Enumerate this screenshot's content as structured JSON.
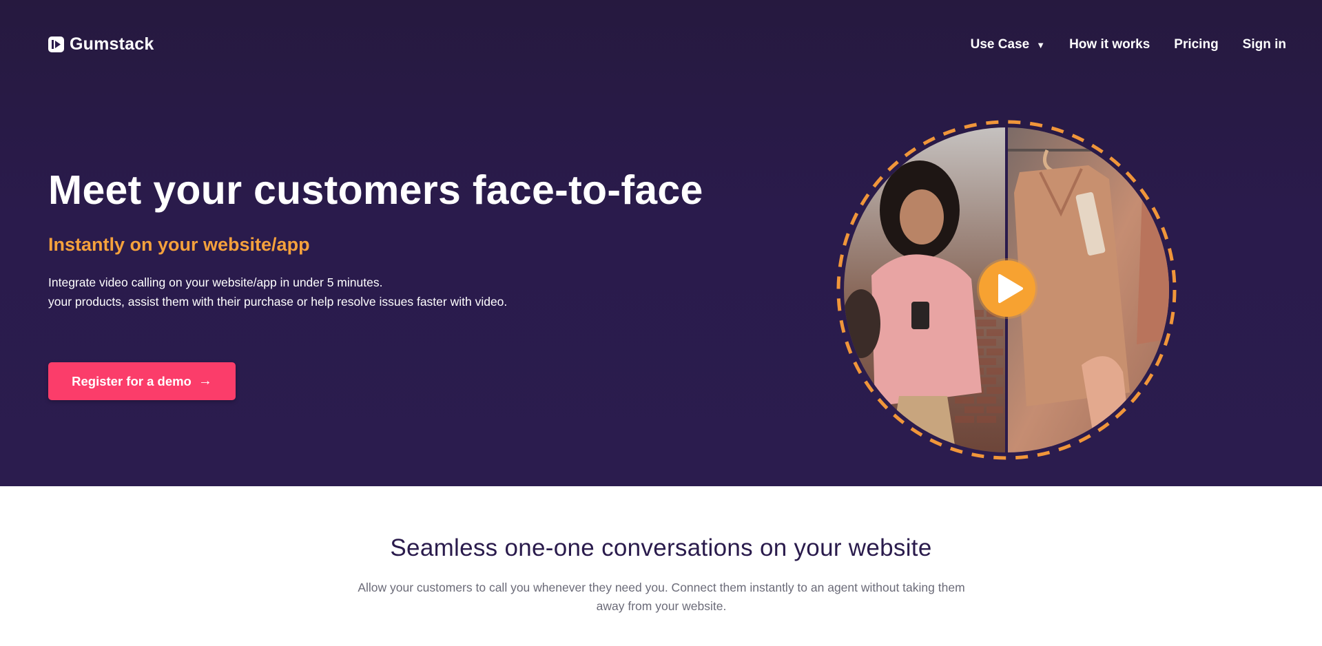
{
  "nav": {
    "brand": "Gumstack",
    "links": [
      "Use Case",
      "How it works",
      "Pricing",
      "Sign in"
    ],
    "use_case_caret": "▼"
  },
  "hero": {
    "title": "Meet your customers face-to-face",
    "subtitle": "Instantly on your website/app",
    "desc_line1": "Integrate video calling on your website/app in under 5 minutes.",
    "desc_line2": "your products, assist them with their purchase or help resolve issues faster with video.",
    "cta_label": "Register for a demo",
    "cta_arrow": "→"
  },
  "video": {
    "icon": "play-icon",
    "ring_color": "#f0963a",
    "play_color": "#f7a231"
  },
  "section2": {
    "title": "Seamless one-one conversations on your website",
    "desc_line1": "Allow your customers to call you whenever they need you. Connect them instantly to an agent without taking them",
    "desc_line2": "away from your website."
  },
  "colors": {
    "hero_bg": "#2a1b4c",
    "accent_orange": "#f5a13c",
    "cta_pink": "#fb3d6a"
  }
}
